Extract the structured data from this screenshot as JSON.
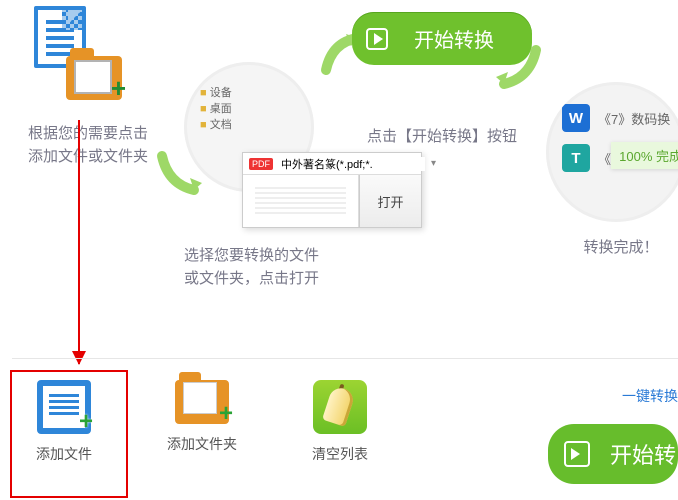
{
  "steps": {
    "s1": {
      "caption": "根据您的需要点击\n添加文件或文件夹"
    },
    "s2": {
      "caption": "选择您要转换的文件\n或文件夹，点击打开",
      "filter": "中外著名篆(*.pdf;*.",
      "openBtn": "打开"
    },
    "s3": {
      "button": "开始转换",
      "caption": "点击【开始转换】按钮"
    },
    "s4": {
      "file1": "《7》数码换",
      "file2": "《7》",
      "progress": "100%  完成",
      "caption": "转换完成！"
    }
  },
  "toolbar": {
    "addFile": "添加文件",
    "addFolder": "添加文件夹",
    "clearList": "清空列表",
    "oneKey": "一键转换",
    "start": "开始转"
  }
}
